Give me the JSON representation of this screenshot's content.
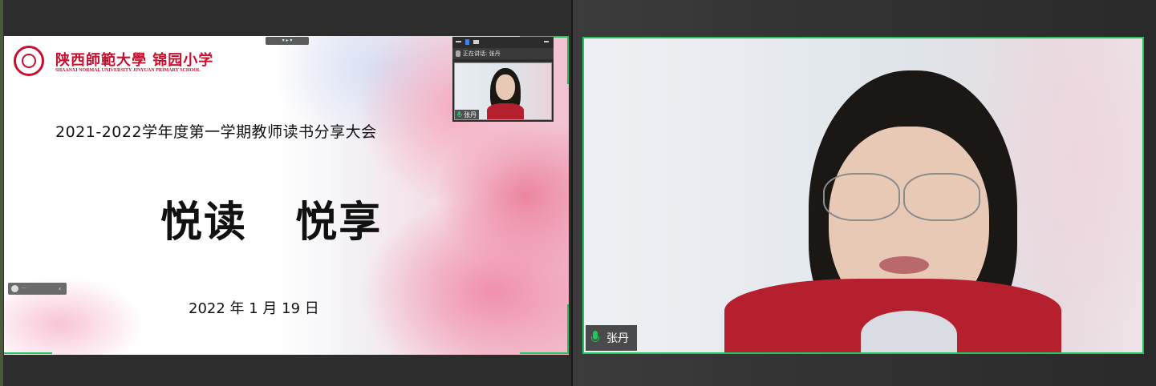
{
  "slide": {
    "school_name_cn": "陕西師範大學 锦园小学",
    "school_name_en": "SHAANXI NORMAL UNIVERSITY JINYUAN PRIMARY SCHOOL",
    "subtitle": "2021-2022学年度第一学期教师读书分享大会",
    "title": "悦读   悦享",
    "date": "2022 年 1 月 19 日"
  },
  "mini_panel": {
    "speaking_label": "正在讲话: 张丹",
    "participant_name": "张丹"
  },
  "main_video": {
    "participant_name": "张丹"
  },
  "icons": {
    "mic": "microphone-icon",
    "logo": "university-seal-icon"
  },
  "colors": {
    "active_border": "#22c55e",
    "brand_red": "#c8102e"
  }
}
